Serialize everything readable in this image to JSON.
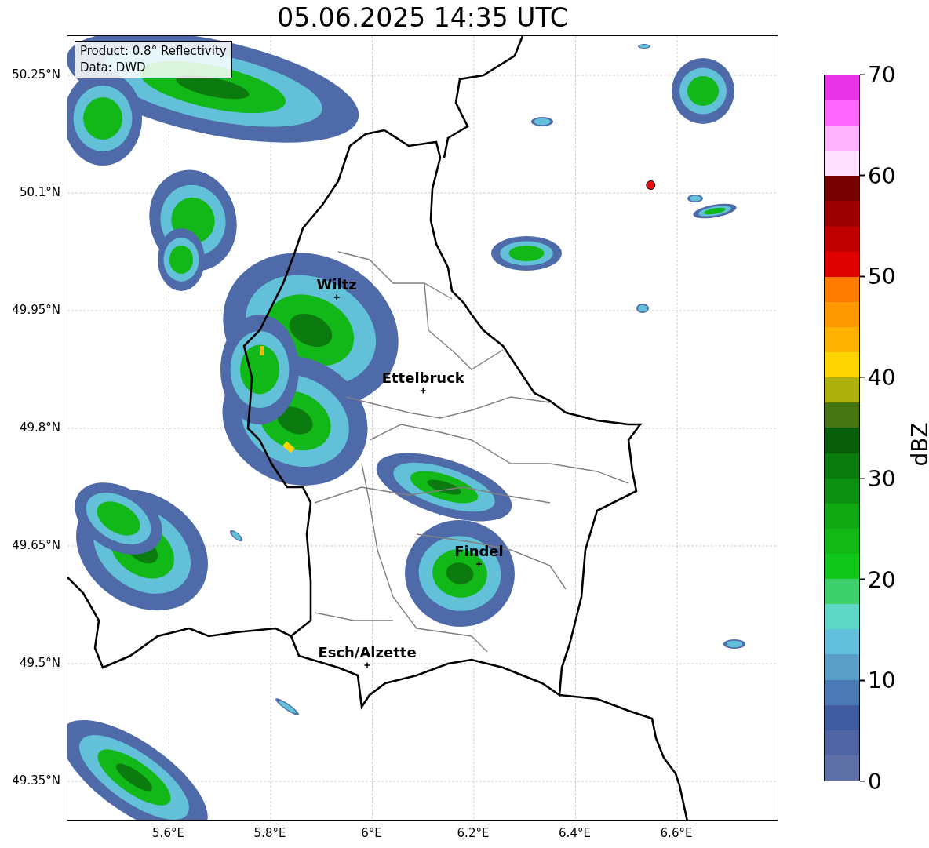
{
  "title": "05.06.2025 14:35 UTC",
  "info_box": {
    "lines": [
      "Product: 0.8° Reflectivity",
      "Data: DWD"
    ]
  },
  "map": {
    "lat_ticks": [
      "50.25°N",
      "50.1°N",
      "49.95°N",
      "49.8°N",
      "49.65°N",
      "49.5°N",
      "49.35°N"
    ],
    "lon_ticks": [
      "5.6°E",
      "5.8°E",
      "6°E",
      "6.2°E",
      "6.4°E",
      "6.6°E"
    ],
    "cities": [
      {
        "name": "Wiltz"
      },
      {
        "name": "Ettelbruck"
      },
      {
        "name": "Findel"
      },
      {
        "name": "Esch/Alzette"
      }
    ]
  },
  "colorbar": {
    "label": "dBZ",
    "levels": [
      {
        "color": "#5e70a6"
      },
      {
        "color": "#4f65a3"
      },
      {
        "color": "#405ba0"
      },
      {
        "color": "#4a79b4"
      },
      {
        "color": "#5b9ec8"
      },
      {
        "color": "#63c0dc"
      },
      {
        "color": "#5fd7c6"
      },
      {
        "color": "#3dd06c"
      },
      {
        "color": "#11c71c"
      },
      {
        "color": "#12b816"
      },
      {
        "color": "#10a813"
      },
      {
        "color": "#0d8f12"
      },
      {
        "color": "#0b7b0f"
      },
      {
        "color": "#095e0c"
      },
      {
        "color": "#477511"
      },
      {
        "color": "#aeb10b"
      },
      {
        "color": "#ffd500"
      },
      {
        "color": "#ffb300"
      },
      {
        "color": "#ff9800"
      },
      {
        "color": "#ff7a00"
      },
      {
        "color": "#e10000"
      },
      {
        "color": "#c00000"
      },
      {
        "color": "#9c0000"
      },
      {
        "color": "#780000"
      },
      {
        "color": "#ffe0ff"
      },
      {
        "color": "#ffb2ff"
      },
      {
        "color": "#ff66ff"
      },
      {
        "color": "#e933e9"
      }
    ],
    "ticks": [
      "70",
      "60",
      "50",
      "40",
      "30",
      "20",
      "10",
      "0"
    ]
  }
}
